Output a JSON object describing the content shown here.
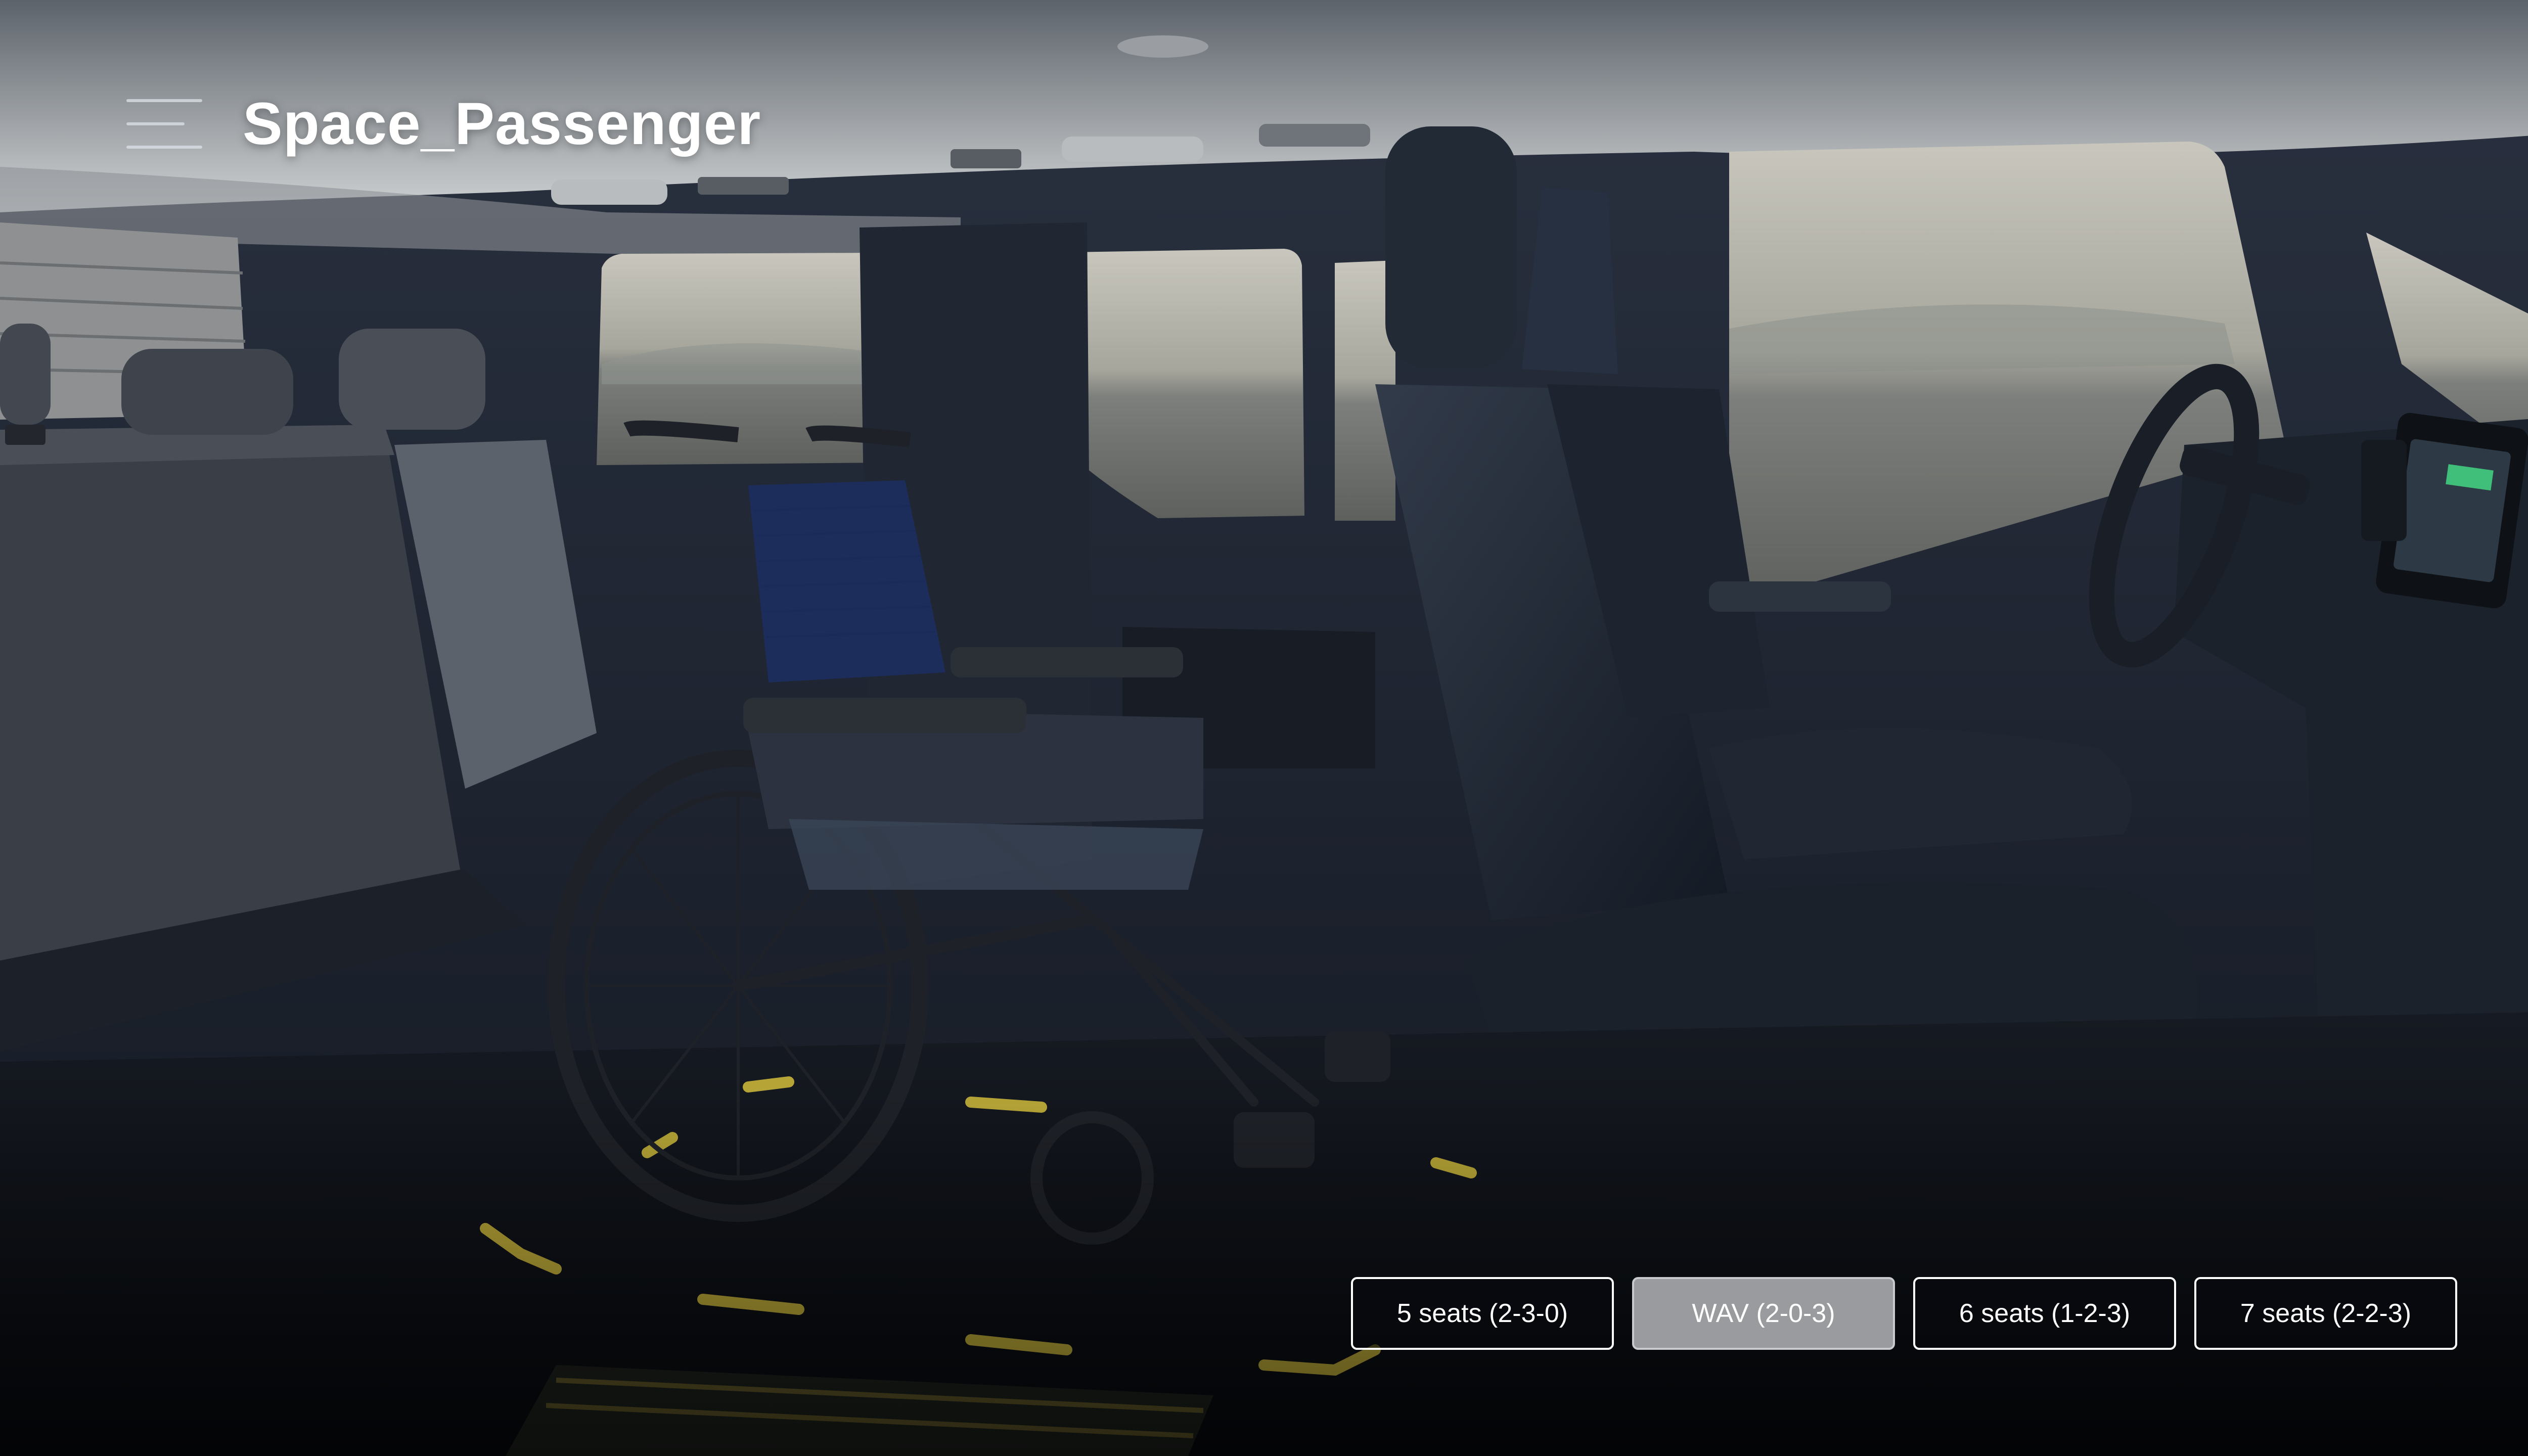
{
  "header": {
    "menu_icon": "hamburger-menu-icon",
    "title": "Space_Passenger"
  },
  "scene": {
    "description_icon": "van-interior-photo"
  },
  "seat_options": {
    "selected_index": 1,
    "items": [
      {
        "label": "5 seats (2-3-0)"
      },
      {
        "label": "WAV (2-0-3)"
      },
      {
        "label": "6 seats (1-2-3)"
      },
      {
        "label": "7 seats (2-2-3)"
      }
    ]
  },
  "colors": {
    "selected_button_bg": "#9a9b9f",
    "button_border": "#ffffff",
    "floor_marking": "#c8b43a"
  }
}
